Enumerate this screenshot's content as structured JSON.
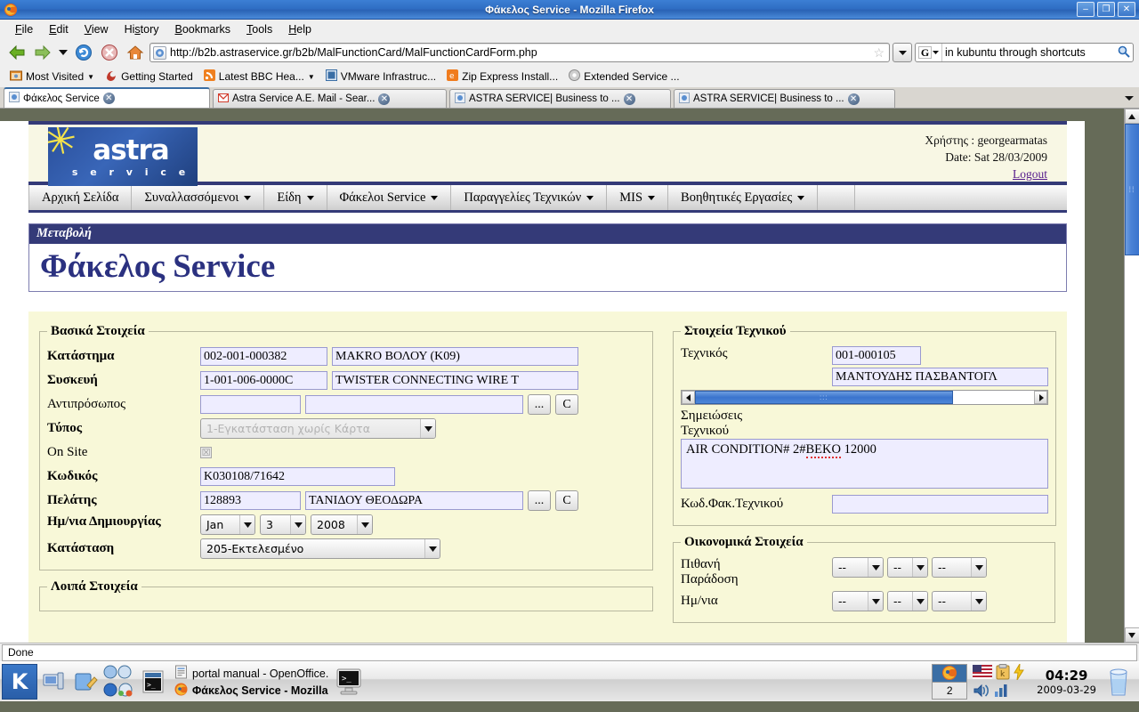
{
  "window": {
    "title": "Φάκελος Service - Mozilla Firefox",
    "minimize": "–",
    "restore": "❐",
    "close": "✕"
  },
  "menubar": [
    {
      "label": "File"
    },
    {
      "label": "Edit"
    },
    {
      "label": "View"
    },
    {
      "label": "History"
    },
    {
      "label": "Bookmarks"
    },
    {
      "label": "Tools"
    },
    {
      "label": "Help"
    }
  ],
  "navbar": {
    "url": "http://b2b.astraservice.gr/b2b/MalFunctionCard/MalFunctionCardForm.php",
    "search_value": "in kubuntu through shortcuts",
    "search_engine": "G",
    "star": "☆",
    "dropdown_caret": "▼"
  },
  "bookmarks": [
    {
      "label": "Most Visited",
      "caret": "▼",
      "icon": "folder-icon"
    },
    {
      "label": "Getting Started",
      "caret": "",
      "icon": "firefox-icon"
    },
    {
      "label": "Latest BBC Hea...",
      "caret": "▼",
      "icon": "rss-icon"
    },
    {
      "label": "VMware Infrastruc...",
      "caret": "",
      "icon": "vmware-icon"
    },
    {
      "label": "Zip Express Install...",
      "caret": "",
      "icon": "zip-icon"
    },
    {
      "label": "Extended Service ...",
      "caret": "",
      "icon": "gear-icon"
    }
  ],
  "tabs": [
    {
      "label": "Φάκελος Service",
      "active": true,
      "close": "✕"
    },
    {
      "label": "Astra Service A.E. Mail - Sear...",
      "active": false,
      "close": "✕"
    },
    {
      "label": "ASTRA SERVICE| Business to ...",
      "active": false,
      "close": "✕"
    },
    {
      "label": "ASTRA SERVICE| Business to ...",
      "active": false,
      "close": "✕"
    }
  ],
  "site": {
    "logo_main": "astra",
    "logo_sub": "s e r v i c e",
    "user_line": "Χρήστης : georgearmatas",
    "date_line": "Date: Sat 28/03/2009",
    "logout": "Logout",
    "nav": [
      {
        "label": "Αρχική Σελίδα",
        "has_caret": false
      },
      {
        "label": "Συναλλασσόμενοι",
        "has_caret": true
      },
      {
        "label": "Είδη",
        "has_caret": true
      },
      {
        "label": "Φάκελοι Service",
        "has_caret": true
      },
      {
        "label": "Παραγγελίες Τεχνικών",
        "has_caret": true
      },
      {
        "label": "MIS",
        "has_caret": true
      },
      {
        "label": "Βοηθητικές Εργασίες",
        "has_caret": true
      }
    ],
    "page_subtitle": "Μεταβολή",
    "page_title": "Φάκελος Service"
  },
  "form": {
    "basic": {
      "legend": "Βασικά Στοιχεία",
      "store_label": "Κατάστημα",
      "store_code": "002-001-000382",
      "store_name": "MAKRO ΒΟΛΟΥ (Κ09)",
      "device_label": "Συσκευή",
      "device_code": "1-001-006-0000C",
      "device_name": "TWISTER CONNECTING WIRE T",
      "agent_label": "Αντιπρόσωπος",
      "agent_code": "",
      "agent_name": "",
      "browse_button": "...",
      "clear_button": "C",
      "type_label": "Τύπος",
      "type_value": "1-Εγκατάσταση χωρίς Κάρτα",
      "onsite_label": "On Site",
      "onsite_checked": "☒",
      "code_label": "Κωδικός",
      "code_value": "K030108/71642",
      "customer_label": "Πελάτης",
      "customer_code": "128893",
      "customer_name": "ΤΑΝΙΔΟΥ ΘΕΟΔΩΡΑ",
      "created_label": "Ημ/νια Δημιουργίας",
      "created_month": "Jan",
      "created_day": "3",
      "created_year": "2008",
      "status_label": "Κατάσταση",
      "status_value": "205-Εκτελεσμένο"
    },
    "other": {
      "legend": "Λοιπά Στοιχεία"
    },
    "technician": {
      "legend": "Στοιχεία Τεχνικού",
      "tech_label": "Τεχνικός",
      "tech_code": "001-000105",
      "tech_name": "ΜΑΝΤΟΥΔΗΣ ΠΑΣΒΑΝΤΟΓΛ",
      "notes_label_1": "Σημειώσεις",
      "notes_label_2": "Τεχνικού",
      "notes_value": "AIR CONDITION# 2#",
      "notes_value_misspelled": "BEKO",
      "notes_value_tail": " 12000",
      "techfile_label": "Κωδ.Φακ.Τεχνικού",
      "techfile_value": ""
    },
    "financial": {
      "legend": "Οικονομικά Στοιχεία",
      "delivery_label_1": "Πιθανή",
      "delivery_label_2": "Παράδοση",
      "date_label": "Ημ/νια",
      "empty_option": "--"
    }
  },
  "scrollbars": {
    "up_arrow": "▲",
    "down_arrow": "▼",
    "left_arrow": "◄",
    "right_arrow": "►",
    "grip": "⋮⋮"
  },
  "status": {
    "text": "Done"
  },
  "taskbar": {
    "kmenu": "K",
    "quick_icons": [
      "show-desktop-icon",
      "kate-icon",
      "konqueror-icon",
      "kmail-icon",
      "konsole-icon",
      "firefox-icon",
      "package-icon"
    ],
    "tasks": [
      {
        "label": "portal manual - OpenOffice.",
        "icon": "openoffice-icon",
        "bold": false
      },
      {
        "label": "Φάκελος Service - Mozilla",
        "icon": "firefox-icon",
        "bold": true
      }
    ],
    "pager_current": "2",
    "clock_time": "04:29",
    "clock_date": "2009-03-29",
    "tray": [
      "keyboard-layout-icon",
      "klipper-icon",
      "power-icon",
      "volume-icon",
      "monitor-icon"
    ]
  },
  "colors": {
    "titlebar_blue": "#2f6ec4",
    "brand_navy": "#343a78",
    "panel_yellow": "#f8f8d8",
    "input_lavender": "#eeedff",
    "desktop_olive": "#666b58",
    "scroll_blue": "#3a74cd"
  }
}
